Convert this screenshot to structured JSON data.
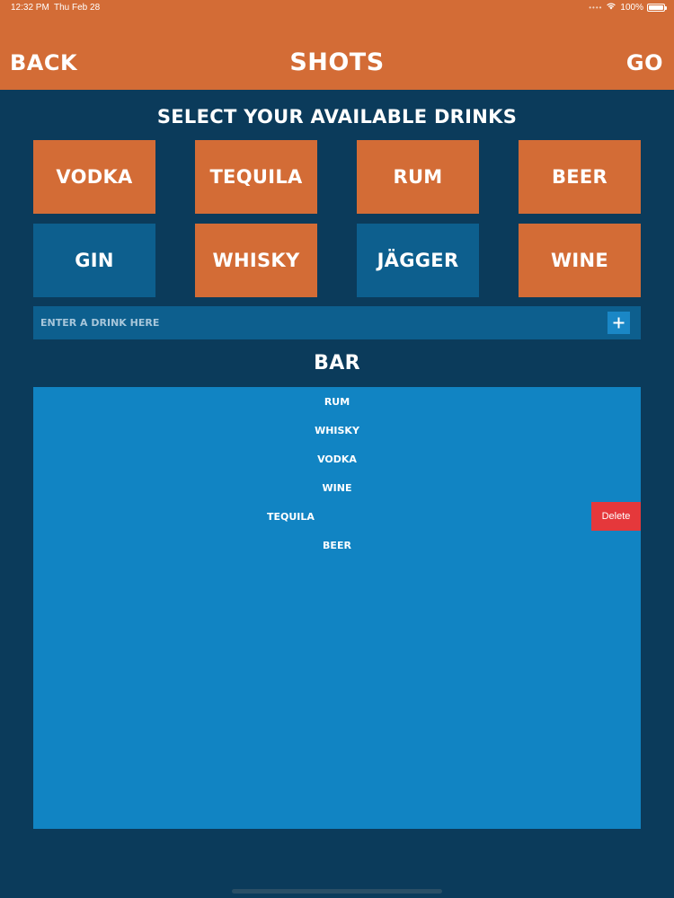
{
  "status_bar": {
    "time": "12:32 PM",
    "date": "Thu Feb 28",
    "battery": "100%"
  },
  "nav": {
    "back_label": "BACK",
    "title": "SHOTS",
    "go_label": "GO"
  },
  "select_heading": "SELECT YOUR AVAILABLE DRINKS",
  "drinks": [
    {
      "label": "VODKA",
      "selected": true
    },
    {
      "label": "TEQUILA",
      "selected": true
    },
    {
      "label": "RUM",
      "selected": true
    },
    {
      "label": "BEER",
      "selected": true
    },
    {
      "label": "GIN",
      "selected": false
    },
    {
      "label": "WHISKY",
      "selected": true
    },
    {
      "label": "JÄGGER",
      "selected": false
    },
    {
      "label": "WINE",
      "selected": true
    }
  ],
  "entry": {
    "placeholder": "ENTER A DRINK HERE",
    "value": ""
  },
  "bar_heading": "BAR",
  "bar_items": [
    {
      "label": "RUM"
    },
    {
      "label": "WHISKY"
    },
    {
      "label": "VODKA"
    },
    {
      "label": "WINE"
    },
    {
      "label": "TEQUILA",
      "delete_label": "Delete"
    },
    {
      "label": "BEER"
    }
  ],
  "colors": {
    "background": "#0b3b5b",
    "accent_orange": "#d36c36",
    "unselected_blue": "#0d5f8e",
    "list_blue": "#1184c3",
    "delete_red": "#e5383b"
  },
  "icons": {
    "wifi": "wifi-icon",
    "battery": "battery-icon",
    "add": "plus-icon"
  }
}
